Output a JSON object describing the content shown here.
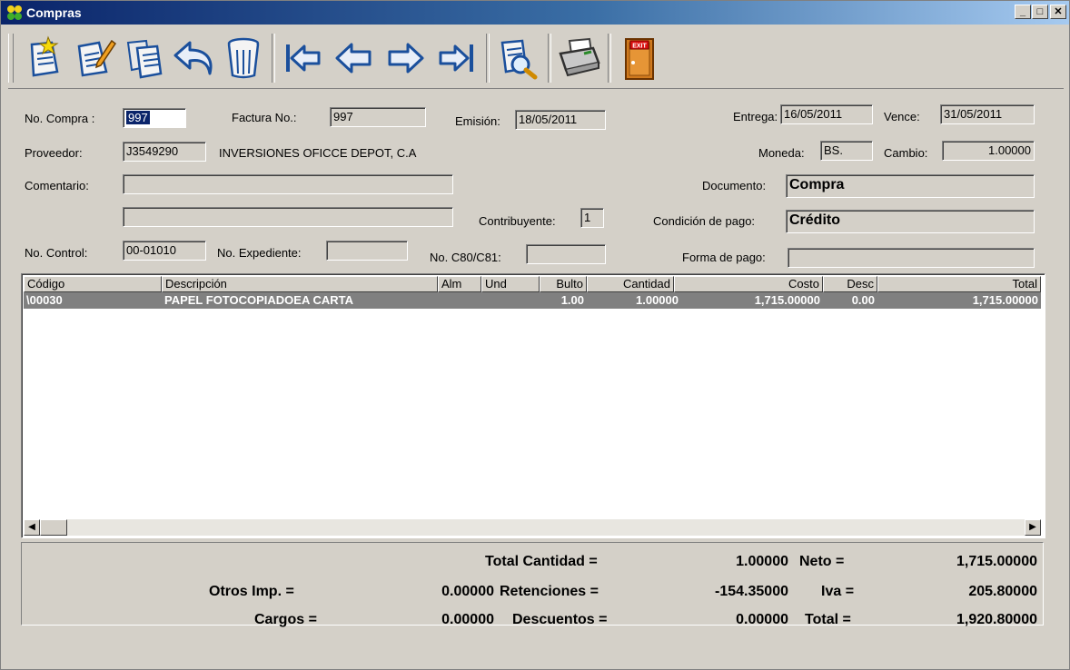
{
  "window": {
    "title": "Compras",
    "buttons": {
      "minimize": "_",
      "maximize": "□",
      "close": "✕"
    }
  },
  "toolbar": {
    "items": [
      {
        "name": "new",
        "icon": "new-document-icon"
      },
      {
        "name": "edit",
        "icon": "edit-document-icon"
      },
      {
        "name": "copy",
        "icon": "copy-documents-icon"
      },
      {
        "name": "undo",
        "icon": "undo-arrow-icon"
      },
      {
        "name": "delete",
        "icon": "trash-icon"
      },
      {
        "name": "first",
        "icon": "first-record-icon"
      },
      {
        "name": "previous",
        "icon": "previous-record-icon"
      },
      {
        "name": "next",
        "icon": "next-record-icon"
      },
      {
        "name": "last",
        "icon": "last-record-icon"
      },
      {
        "name": "search",
        "icon": "search-document-icon"
      },
      {
        "name": "print",
        "icon": "printer-icon"
      },
      {
        "name": "exit",
        "icon": "exit-door-icon",
        "label": "EXIT"
      }
    ]
  },
  "form": {
    "no_compra": {
      "label": "No. Compra :",
      "value": "997"
    },
    "factura": {
      "label": "Factura No.:",
      "value": "997"
    },
    "emision": {
      "label": "Emisión:",
      "value": "18/05/2011"
    },
    "entrega": {
      "label": "Entrega:",
      "value": "16/05/2011"
    },
    "vence": {
      "label": "Vence:",
      "value": "31/05/2011"
    },
    "proveedor": {
      "label": "Proveedor:",
      "code": "J3549290",
      "name": "INVERSIONES OFICCE DEPOT, C.A"
    },
    "moneda": {
      "label": "Moneda:",
      "value": "BS."
    },
    "cambio": {
      "label": "Cambio:",
      "value": "1.00000"
    },
    "comentario": {
      "label": "Comentario:",
      "line1": "",
      "line2": ""
    },
    "documento": {
      "label": "Documento:",
      "value": "Compra"
    },
    "contribuyente": {
      "label": "Contribuyente:",
      "value": "1"
    },
    "condicion_pago": {
      "label": "Condición de pago:",
      "value": "Crédito"
    },
    "no_control": {
      "label": "No. Control:",
      "value": "00-01010"
    },
    "no_expediente": {
      "label": "No. Expediente:",
      "value": ""
    },
    "no_c80": {
      "label": "No. C80/C81:",
      "value": ""
    },
    "forma_pago": {
      "label": "Forma de pago:",
      "value": ""
    }
  },
  "grid": {
    "columns": [
      "Código",
      "Descripción",
      "Alm",
      "Und",
      "Bulto",
      "Cantidad",
      "Costo",
      "Desc",
      "Total"
    ],
    "rows": [
      [
        "\\00030",
        "PAPEL FOTOCOPIADOEA CARTA",
        "",
        "",
        "1.00",
        "1.00000",
        "1,715.00000",
        "0.00",
        "1,715.00000"
      ]
    ]
  },
  "totals": {
    "total_cantidad": {
      "label": "Total Cantidad =",
      "value": "1.00000"
    },
    "neto": {
      "label": "Neto =",
      "value": "1,715.00000"
    },
    "otros_imp": {
      "label": "Otros Imp. =",
      "value": "0.00000"
    },
    "retenciones": {
      "label": "Retenciones =",
      "value": "-154.35000"
    },
    "iva": {
      "label": "Iva =",
      "value": "205.80000"
    },
    "cargos": {
      "label": "Cargos =",
      "value": "0.00000"
    },
    "descuentos": {
      "label": "Descuentos =",
      "value": "0.00000"
    },
    "total": {
      "label": "Total =",
      "value": "1,920.80000"
    }
  },
  "colors": {
    "title_start": "#0a246a",
    "title_end": "#a6caf0",
    "face": "#d4d0c8",
    "selected_row": "#808080"
  }
}
